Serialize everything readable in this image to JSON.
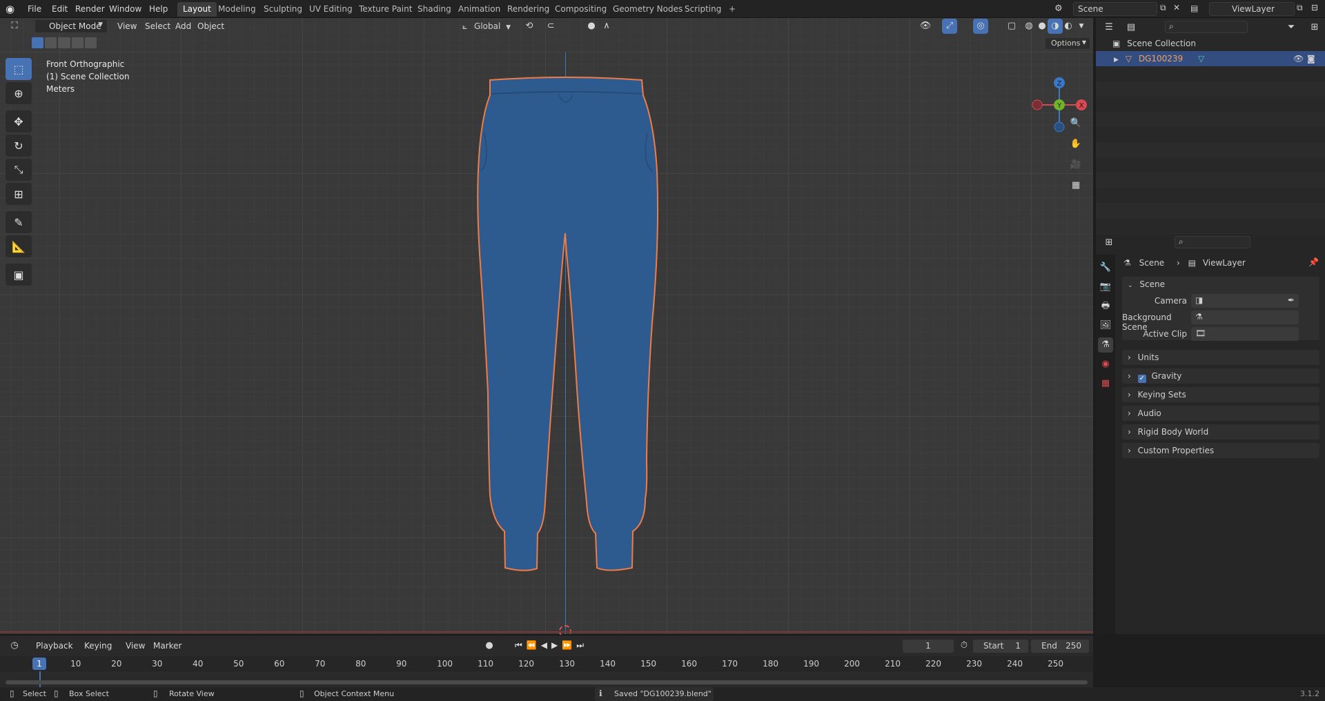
{
  "topbar": {
    "menus": [
      "File",
      "Edit",
      "Render",
      "Window",
      "Help"
    ],
    "workspaces": [
      "Layout",
      "Modeling",
      "Sculpting",
      "UV Editing",
      "Texture Paint",
      "Shading",
      "Animation",
      "Rendering",
      "Compositing",
      "Geometry Nodes",
      "Scripting"
    ],
    "active_workspace": "Layout",
    "add_tab": "+",
    "scene_name": "Scene",
    "view_layer": "ViewLayer"
  },
  "viewport": {
    "mode": "Object Mode",
    "menus": [
      "View",
      "Select",
      "Add",
      "Object"
    ],
    "transform_orientation": "Global",
    "options_label": "Options",
    "overlay_text": [
      "Front Orthographic",
      "(1) Scene Collection",
      "Meters"
    ],
    "gizmo": {
      "z": "Z",
      "y": "Y",
      "x": "X"
    },
    "object_color": "#2e5b8f",
    "outline_color": "#f07c47"
  },
  "outliner": {
    "root": "Scene Collection",
    "items": [
      {
        "name": "DG100239"
      }
    ]
  },
  "properties": {
    "breadcrumb": [
      "Scene",
      "ViewLayer"
    ],
    "section": "Scene",
    "fields": [
      {
        "label": "Camera"
      },
      {
        "label": "Background Scene"
      },
      {
        "label": "Active Clip"
      }
    ],
    "panels": [
      "Units",
      "Gravity",
      "Keying Sets",
      "Audio",
      "Rigid Body World",
      "Custom Properties"
    ],
    "gravity_checked": true
  },
  "timeline": {
    "menus": [
      "Playback",
      "Keying",
      "View",
      "Marker"
    ],
    "current_frame": "1",
    "start_label": "Start",
    "start": "1",
    "end_label": "End",
    "end": "250",
    "ticks": [
      "1",
      "10",
      "20",
      "30",
      "40",
      "50",
      "60",
      "70",
      "80",
      "90",
      "100",
      "110",
      "120",
      "130",
      "140",
      "150",
      "160",
      "170",
      "180",
      "190",
      "200",
      "210",
      "220",
      "230",
      "240",
      "250"
    ]
  },
  "statusbar": {
    "select": "Select",
    "box_select": "Box Select",
    "rotate": "Rotate View",
    "context": "Object Context Menu",
    "message": "Saved \"DG100239.blend\"",
    "version": "3.1.2"
  }
}
